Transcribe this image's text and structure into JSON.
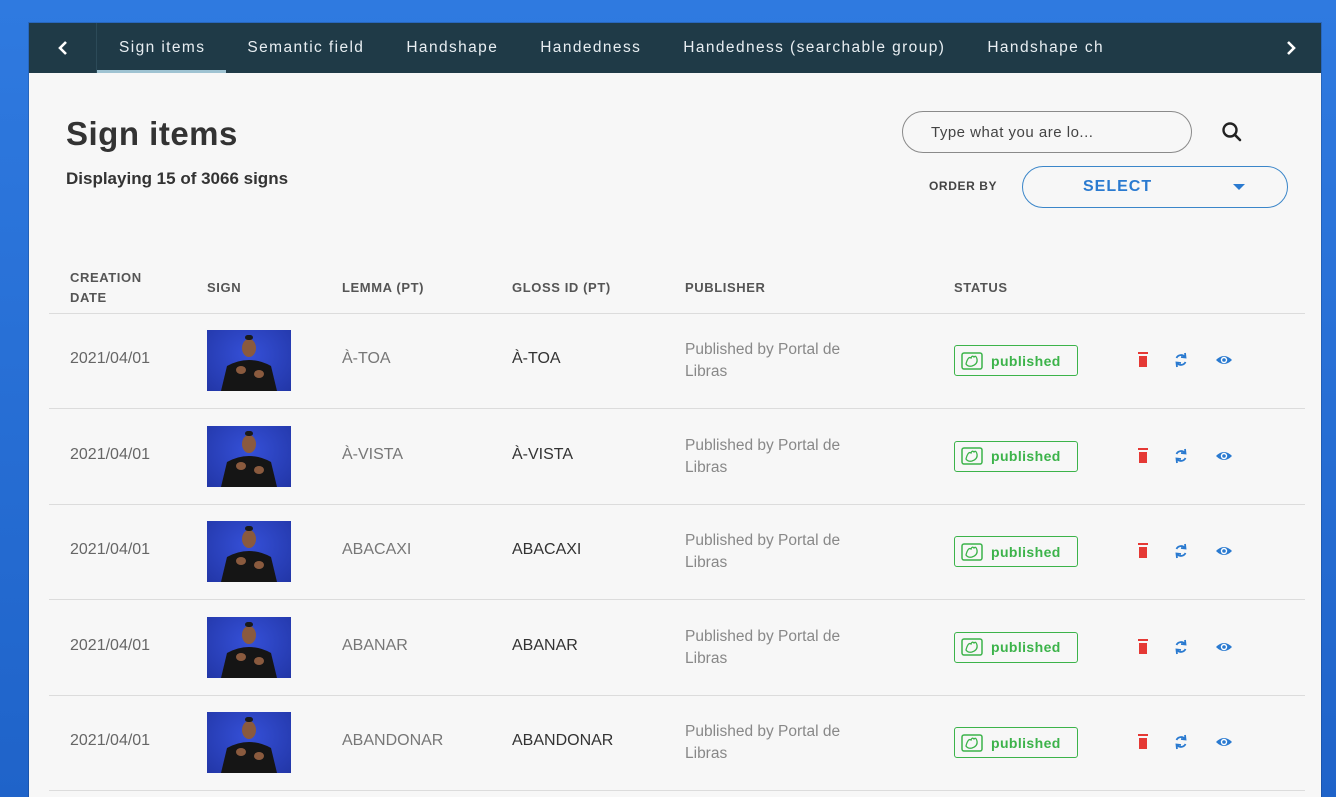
{
  "tabs": [
    {
      "label": "Sign items",
      "active": true
    },
    {
      "label": "Semantic field"
    },
    {
      "label": "Handshape"
    },
    {
      "label": "Handedness"
    },
    {
      "label": "Handedness (searchable group)"
    },
    {
      "label": "Handshape ch"
    }
  ],
  "header": {
    "title": "Sign items",
    "count_text": "Displaying 15 of 3066 signs"
  },
  "search": {
    "placeholder": "Type what you are lo..."
  },
  "order": {
    "label": "ORDER BY",
    "value": "SELECT"
  },
  "table": {
    "columns": {
      "creation_line1": "CREATION",
      "creation_line2": "DATE",
      "sign": "SIGN",
      "lemma": "LEMMA (PT)",
      "gloss": "GLOSS ID (PT)",
      "publisher": "PUBLISHER",
      "status": "STATUS"
    },
    "rows": [
      {
        "date": "2021/04/01",
        "lemma": "À-TOA",
        "gloss": "À-TOA",
        "publisher": "Published by Portal de Libras",
        "status": "published"
      },
      {
        "date": "2021/04/01",
        "lemma": "À-VISTA",
        "gloss": "À-VISTA",
        "publisher": "Published by Portal de Libras",
        "status": "published"
      },
      {
        "date": "2021/04/01",
        "lemma": "ABACAXI",
        "gloss": "ABACAXI",
        "publisher": "Published by Portal de Libras",
        "status": "published"
      },
      {
        "date": "2021/04/01",
        "lemma": "ABANAR",
        "gloss": "ABANAR",
        "publisher": "Published by Portal de Libras",
        "status": "published"
      },
      {
        "date": "2021/04/01",
        "lemma": "ABANDONAR",
        "gloss": "ABANDONAR",
        "publisher": "Published by Portal de Libras",
        "status": "published"
      }
    ]
  },
  "colors": {
    "tabbar_bg": "#1f3a47",
    "accent_blue": "#2a7ad0",
    "status_green": "#3cb34a",
    "delete_red": "#e53935"
  },
  "icons": {
    "tab_prev": "chevron-left-icon",
    "tab_next": "chevron-right-icon",
    "search": "search-icon",
    "order_caret": "caret-down-icon",
    "status": "hands-icon",
    "delete": "trash-icon",
    "sync": "sync-icon",
    "view": "eye-icon"
  }
}
